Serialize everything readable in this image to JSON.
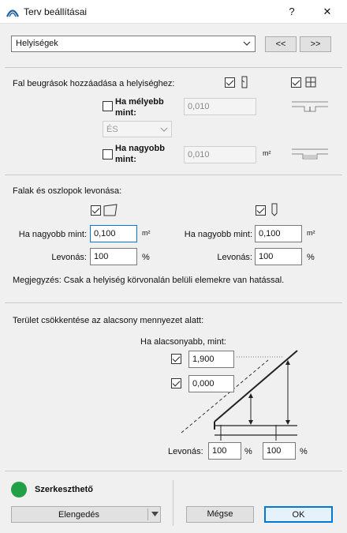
{
  "window": {
    "title": "Terv beállításai",
    "help_label": "?",
    "close_label": "✕"
  },
  "header": {
    "dropdown_value": "Helyiségek",
    "prev_label": "<<",
    "next_label": ">>"
  },
  "wall_niches": {
    "heading": "Fal beugrások hozzáadása a helyiséghez:",
    "deeper_label_1": "Ha mélyebb",
    "deeper_label_2": "mint:",
    "deeper_value": "0,010",
    "logic_value": "ÉS",
    "larger_label_1": "Ha nagyobb",
    "larger_label_2": "mint:",
    "larger_value": "0,010",
    "larger_unit": "m²"
  },
  "deduction": {
    "heading": "Falak és oszlopok levonása:",
    "left": {
      "min_label": "Ha nagyobb mint:",
      "min_value": "0,100",
      "min_unit": "m²",
      "deduct_label": "Levonás:",
      "deduct_value": "100",
      "deduct_unit": "%"
    },
    "right": {
      "min_label": "Ha nagyobb mint:",
      "min_value": "0,100",
      "min_unit": "m²",
      "deduct_label": "Levonás:",
      "deduct_value": "100",
      "deduct_unit": "%"
    },
    "note": "Megjegyzés: Csak a helyiség körvonalán belüli elemekre van hatással."
  },
  "ceiling": {
    "heading": "Terület csökkentése az alacsony mennyezet alatt:",
    "below_label": "Ha alacsonyabb, mint:",
    "height1": "1,900",
    "height2": "0,000",
    "deduct_label": "Levonás:",
    "deduct1": "100",
    "deduct1_unit": "%",
    "deduct2": "100",
    "deduct2_unit": "%"
  },
  "footer": {
    "status_label": "Szerkeszthető",
    "status_color": "#22a046",
    "release_label": "Elengedés",
    "cancel_label": "Mégse",
    "ok_label": "OK"
  }
}
